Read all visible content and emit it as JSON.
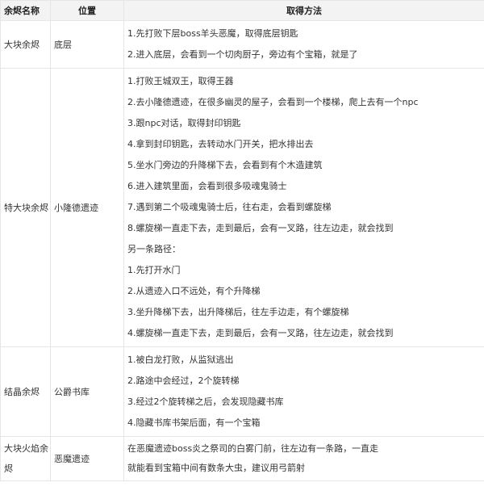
{
  "headers": {
    "name": "余烬名称",
    "location": "位置",
    "method": "取得方法"
  },
  "rows": [
    {
      "name": "大块余烬",
      "location": "底层",
      "lines": [
        "1.先打败下层boss羊头恶魔，取得底层钥匙",
        "2.进入底层，会看到一个切肉厨子，旁边有个宝箱，就是了"
      ]
    },
    {
      "name": "特大块余烬",
      "location": "小隆德遗迹",
      "lines": [
        "1.打败王城双王，取得王器",
        "2.去小隆德遗迹，在很多幽灵的屋子，会看到一个楼梯，爬上去有一个npc",
        "3.跟npc对话，取得封印钥匙",
        "4.拿到封印钥匙，去转动水门开关，把水排出去",
        "5.坐水门旁边的升降梯下去，会看到有个木造建筑",
        "6.进入建筑里面，会看到很多吸魂鬼骑士",
        "7.遇到第二个吸魂鬼骑士后，往右走，会看到螺旋梯",
        "8.螺旋梯一直走下去，走到最后，会有一叉路，往左边走，就会找到",
        "另一条路径：",
        "1.先打开水门",
        "2.从遗迹入口不远处，有个升降梯",
        "3.坐升降梯下去，出升降梯后，往左手边走，有个螺旋梯",
        "4.螺旋梯一直走下去，走到最后，会有一叉路，往左边走，就会找到"
      ]
    },
    {
      "name": "结晶余烬",
      "location": "公爵书库",
      "lines": [
        "1.被白龙打败，从监狱逃出",
        "2.路途中会经过，2个旋转梯",
        "3.经过2个旋转梯之后，会发现隐藏书库",
        "4.隐藏书库书架后面，有一个宝箱"
      ]
    },
    {
      "name": "大块火焰余烬",
      "location": "恶魔遗迹",
      "lines": [
        "在恶魔遗迹boss炎之祭司的白雾门前，往左边有一条路，一直走",
        "就能看到宝箱中间有数条大虫，建议用弓箭射"
      ]
    }
  ]
}
